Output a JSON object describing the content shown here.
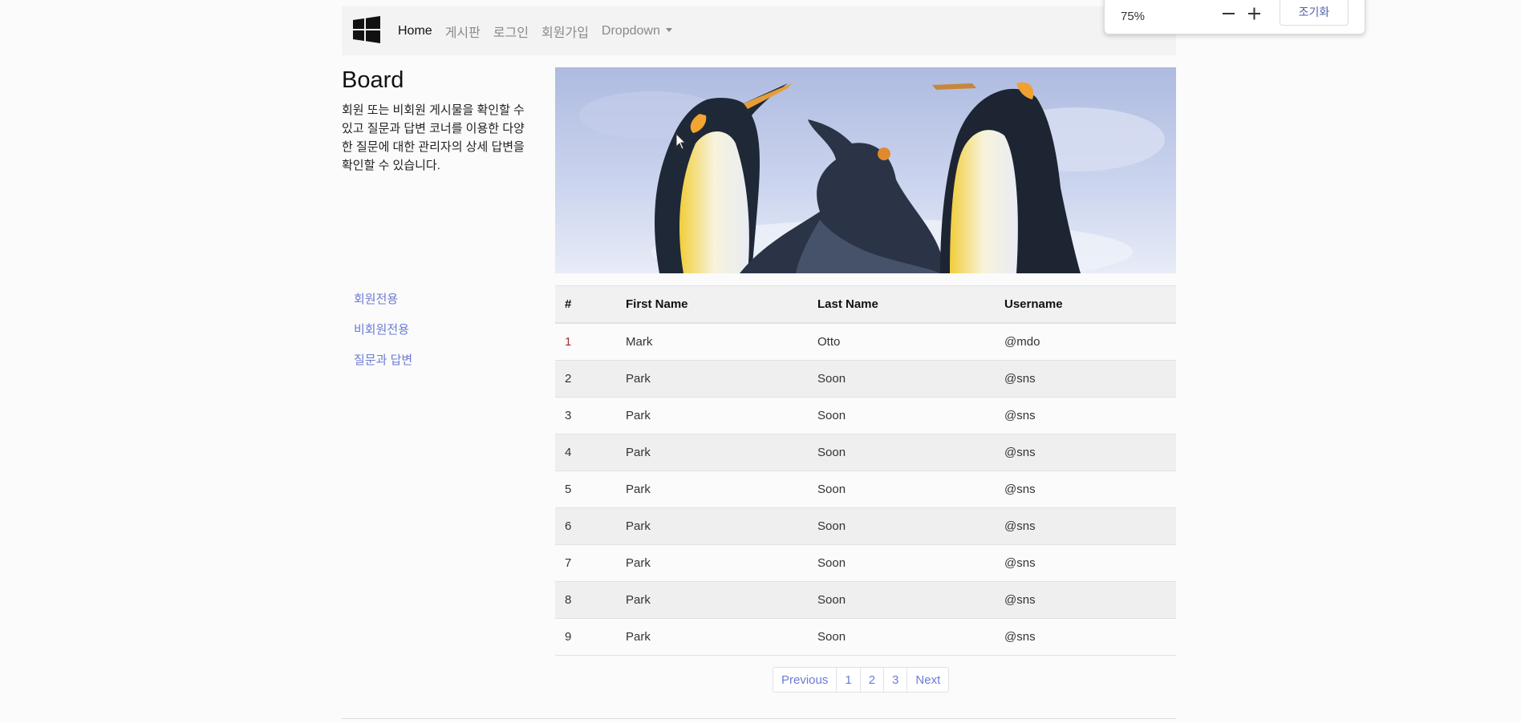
{
  "navbar": {
    "items": [
      {
        "label": "Home",
        "active": true
      },
      {
        "label": "게시판",
        "active": false
      },
      {
        "label": "로그인",
        "active": false
      },
      {
        "label": "회원가입",
        "active": false
      },
      {
        "label": "Dropdown",
        "active": false,
        "dropdown": true
      }
    ],
    "brand_icon": "windows-logo-icon"
  },
  "zoom": {
    "level": "75%",
    "reset_label": "조기화",
    "minus_icon": "minus-icon",
    "plus_icon": "plus-icon"
  },
  "board": {
    "title": "Board",
    "description": "회원 또는 비회원 게시물을 확인할 수 있고 질문과 답변 코너를 이용한 다양한 질문에 대한 관리자의 상세 답변을 확인할 수 있습니다."
  },
  "sidebar": {
    "items": [
      {
        "label": "회원전용"
      },
      {
        "label": "비회원전용"
      },
      {
        "label": "질문과 답변"
      }
    ]
  },
  "table": {
    "headers": [
      "#",
      "First Name",
      "Last Name",
      "Username"
    ],
    "rows": [
      [
        "1",
        "Mark",
        "Otto",
        "@mdo"
      ],
      [
        "2",
        "Park",
        "Soon",
        "@sns"
      ],
      [
        "3",
        "Park",
        "Soon",
        "@sns"
      ],
      [
        "4",
        "Park",
        "Soon",
        "@sns"
      ],
      [
        "5",
        "Park",
        "Soon",
        "@sns"
      ],
      [
        "6",
        "Park",
        "Soon",
        "@sns"
      ],
      [
        "7",
        "Park",
        "Soon",
        "@sns"
      ],
      [
        "8",
        "Park",
        "Soon",
        "@sns"
      ],
      [
        "9",
        "Park",
        "Soon",
        "@sns"
      ]
    ]
  },
  "pagination": {
    "previous": "Previous",
    "pages": [
      "1",
      "2",
      "3"
    ],
    "next": "Next"
  },
  "colors": {
    "link": "#6b7bd6",
    "navbar_bg": "#f3f3f3",
    "page_bg": "#fbfbfb"
  }
}
